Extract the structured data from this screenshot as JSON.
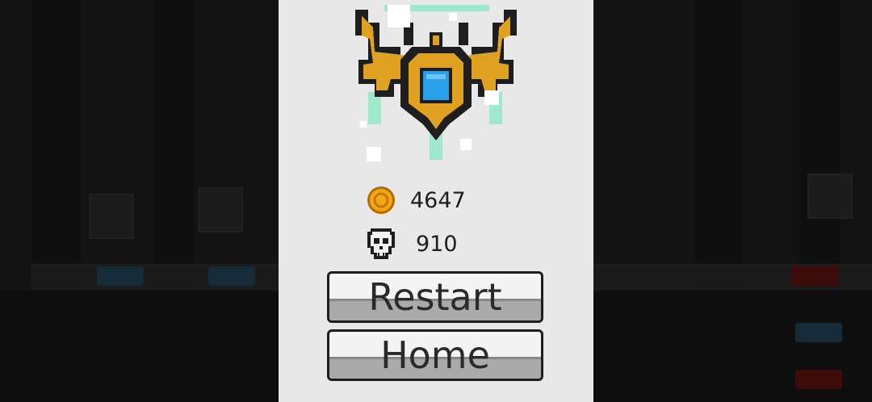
{
  "stats": {
    "coins": "4647",
    "kills": "910"
  },
  "buttons": {
    "restart": "Restart",
    "home": "Home"
  },
  "icons": {
    "emblem": "golden-winged-emblem-icon",
    "coin": "coin-icon",
    "skull": "skull-icon"
  },
  "colors": {
    "panel": "#e8e8e8",
    "gold": "#e0a020",
    "gem": "#2aa0e8",
    "aura": "#9ee8cc",
    "button_shade": "#aaaaaa",
    "arrow_blue": "#2f5f7a",
    "arrow_red": "#8a1a1a"
  }
}
